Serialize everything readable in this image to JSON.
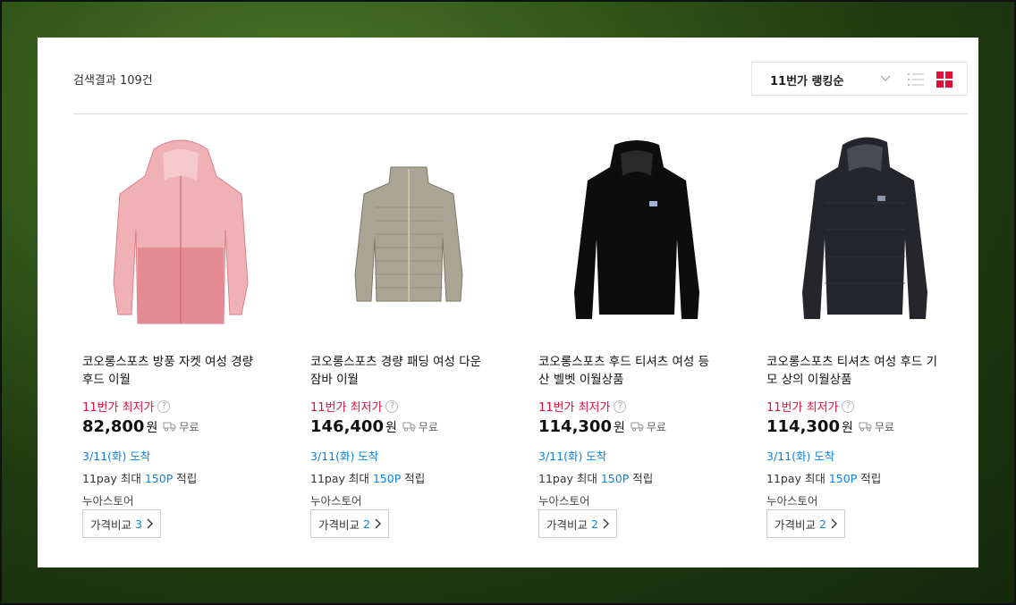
{
  "results": {
    "label": "검색결과 109건"
  },
  "sort": {
    "selected": "11번가 랭킹순",
    "chevron_icon": "chevron-down-icon",
    "list_icon": "list-view-icon",
    "grid_icon": "grid-view-icon",
    "grid_color": "#e0103a"
  },
  "products": [
    {
      "title_line1": "코오롱스포츠 방풍 자켓 여성 경량",
      "title_line2": "후드 이월",
      "best_label": "11번가 최저가",
      "price": "82,800",
      "unit": "원",
      "shipping": "무료",
      "arrival": "3/11(화) 도착",
      "point_prefix": "11pay 최대 ",
      "point_value": "150P",
      "point_suffix": " 적립",
      "seller": "누아스토어",
      "compare_label": "가격비교",
      "compare_count": "3",
      "image_color": "#e89aa0"
    },
    {
      "title_line1": "코오롱스포츠 경량 패딩 여성 다운",
      "title_line2": "잠바 이월",
      "best_label": "11번가 최저가",
      "price": "146,400",
      "unit": "원",
      "shipping": "무료",
      "arrival": "3/11(화) 도착",
      "point_prefix": "11pay 최대 ",
      "point_value": "150P",
      "point_suffix": " 적립",
      "seller": "누아스토어",
      "compare_label": "가격비교",
      "compare_count": "2",
      "image_color": "#a39c8b"
    },
    {
      "title_line1": "코오롱스포츠 후드 티셔츠 여성 등",
      "title_line2": "산 벨벳 이월상품",
      "best_label": "11번가 최저가",
      "price": "114,300",
      "unit": "원",
      "shipping": "무료",
      "arrival": "3/11(화) 도착",
      "point_prefix": "11pay 최대 ",
      "point_value": "150P",
      "point_suffix": " 적립",
      "seller": "누아스토어",
      "compare_label": "가격비교",
      "compare_count": "2",
      "image_color": "#111111"
    },
    {
      "title_line1": "코오롱스포츠 티셔츠 여성 후드 기",
      "title_line2": "모 상의 이월상품",
      "best_label": "11번가 최저가",
      "price": "114,300",
      "unit": "원",
      "shipping": "무료",
      "arrival": "3/11(화) 도착",
      "point_prefix": "11pay 최대 ",
      "point_value": "150P",
      "point_suffix": " 적립",
      "seller": "누아스토어",
      "compare_label": "가격비교",
      "compare_count": "2",
      "image_color": "#25262b"
    }
  ]
}
